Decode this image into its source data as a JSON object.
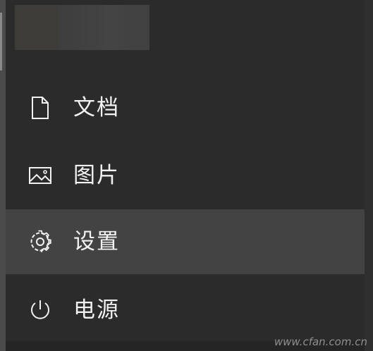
{
  "menu": {
    "items": [
      {
        "label": "文档",
        "icon": "document-icon"
      },
      {
        "label": "图片",
        "icon": "picture-icon"
      },
      {
        "label": "设置",
        "icon": "gear-icon",
        "active": true
      },
      {
        "label": "电源",
        "icon": "power-icon"
      }
    ]
  },
  "watermark": "www.cfan.com.cn",
  "colors": {
    "background": "#2b2b2b",
    "active_background": "#434343",
    "text": "#f2f2f2"
  }
}
